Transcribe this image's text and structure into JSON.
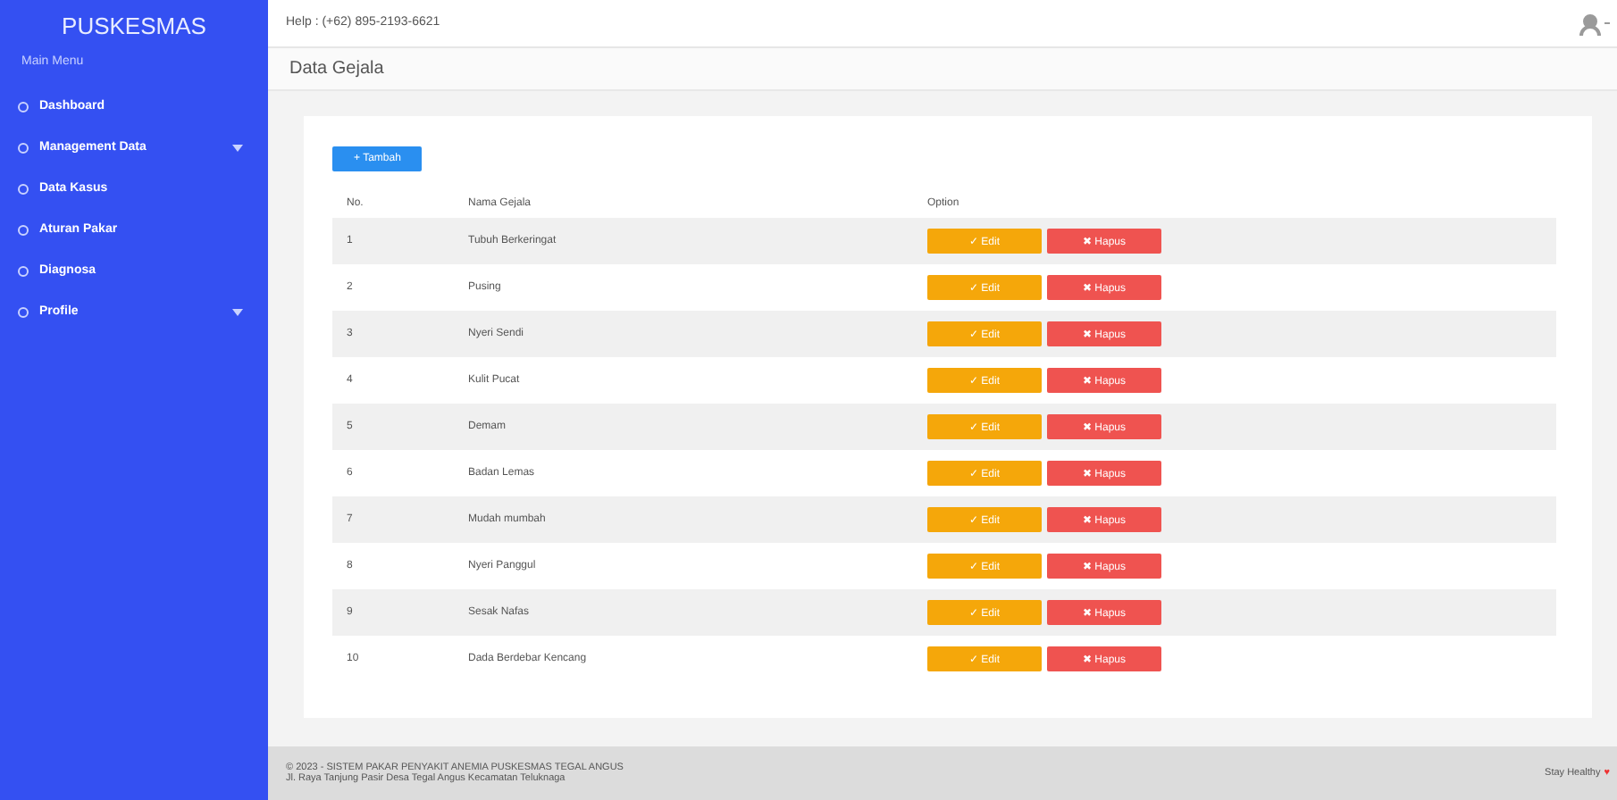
{
  "sidebar": {
    "brand": "PUSKESMAS",
    "section": "Main Menu",
    "items": [
      {
        "label": "Dashboard",
        "has_submenu": false
      },
      {
        "label": "Management Data",
        "has_submenu": true
      },
      {
        "label": "Data Kasus",
        "has_submenu": false
      },
      {
        "label": "Aturan Pakar",
        "has_submenu": false
      },
      {
        "label": "Diagnosa",
        "has_submenu": false
      },
      {
        "label": "Profile",
        "has_submenu": true
      }
    ]
  },
  "topbar": {
    "help": "Help : (+62) 895-2193-6621"
  },
  "page": {
    "title": "Data Gejala",
    "add_button": "+ Tambah",
    "table": {
      "columns": [
        "No.",
        "Nama Gejala",
        "Option"
      ],
      "rows": [
        {
          "no": "1",
          "name": "Tubuh Berkeringat",
          "edit": "✓ Edit",
          "delete": "✖ Hapus"
        },
        {
          "no": "2",
          "name": "Pusing",
          "edit": "✓ Edit",
          "delete": "✖ Hapus"
        },
        {
          "no": "3",
          "name": "Nyeri Sendi",
          "edit": "✓ Edit",
          "delete": "✖ Hapus"
        },
        {
          "no": "4",
          "name": "Kulit Pucat",
          "edit": "✓ Edit",
          "delete": "✖ Hapus"
        },
        {
          "no": "5",
          "name": "Demam",
          "edit": "✓ Edit",
          "delete": "✖ Hapus"
        },
        {
          "no": "6",
          "name": "Badan Lemas",
          "edit": "✓ Edit",
          "delete": "✖ Hapus"
        },
        {
          "no": "7",
          "name": "Mudah mumbah",
          "edit": "✓ Edit",
          "delete": "✖ Hapus"
        },
        {
          "no": "8",
          "name": "Nyeri Panggul",
          "edit": "✓ Edit",
          "delete": "✖ Hapus"
        },
        {
          "no": "9",
          "name": "Sesak Nafas",
          "edit": "✓ Edit",
          "delete": "✖ Hapus"
        },
        {
          "no": "10",
          "name": "Dada Berdebar Kencang",
          "edit": "✓ Edit",
          "delete": "✖ Hapus"
        }
      ]
    }
  },
  "footer": {
    "copyright": "© 2023 - SISTEM PAKAR PENYAKIT ANEMIA PUSKESMAS TEGAL ANGUS",
    "address": "Jl. Raya Tanjung Pasir Desa Tegal Angus Kecamatan Teluknaga",
    "tagline": "Stay Healthy",
    "heart": "♥"
  }
}
